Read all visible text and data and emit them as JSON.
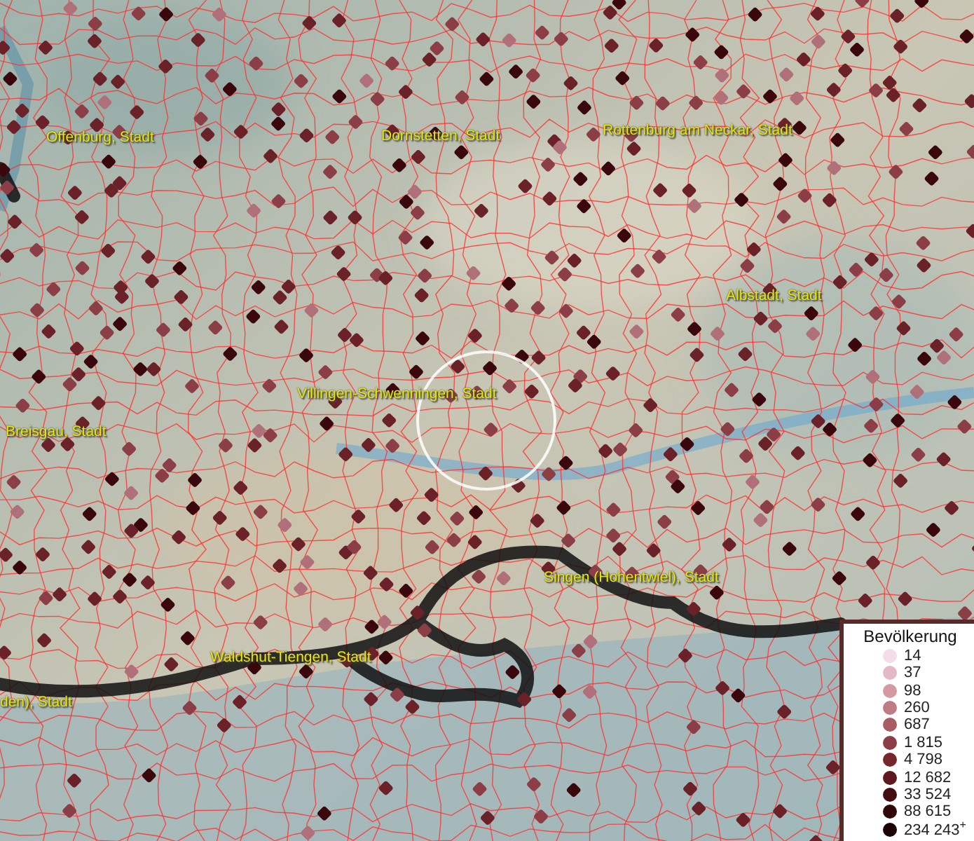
{
  "map": {
    "labels": [
      {
        "text": "Offenburg, Stadt"
      },
      {
        "text": "Dornstetten, Stadt"
      },
      {
        "text": "Rottenburg am Neckar, Stadt"
      },
      {
        "text": "Albstadt, Stadt"
      },
      {
        "text": "Villingen-Schwenningen, Stadt"
      },
      {
        "text": "Breisgau, Stadt"
      },
      {
        "text": "Singen (Hohentwiel), Stadt"
      },
      {
        "text": "Waldshut-Tiengen, Stadt"
      },
      {
        "text": "den), Stadt"
      }
    ]
  },
  "legend": {
    "title": "Bevölkerung",
    "items": [
      {
        "value": "14",
        "color": "#f4dce8"
      },
      {
        "value": "37",
        "color": "#e4b8c4"
      },
      {
        "value": "98",
        "color": "#d49aa4"
      },
      {
        "value": "260",
        "color": "#c07c84"
      },
      {
        "value": "687",
        "color": "#a85c64"
      },
      {
        "value": "1 815",
        "color": "#8c3e46"
      },
      {
        "value": "4 798",
        "color": "#74282e"
      },
      {
        "value": "12 682",
        "color": "#5c1a1e"
      },
      {
        "value": "33 524",
        "color": "#440e10"
      },
      {
        "value": "88 615",
        "color": "#300808"
      },
      {
        "value": "234 243$^{+}$",
        "color": "#1c0404"
      }
    ]
  }
}
